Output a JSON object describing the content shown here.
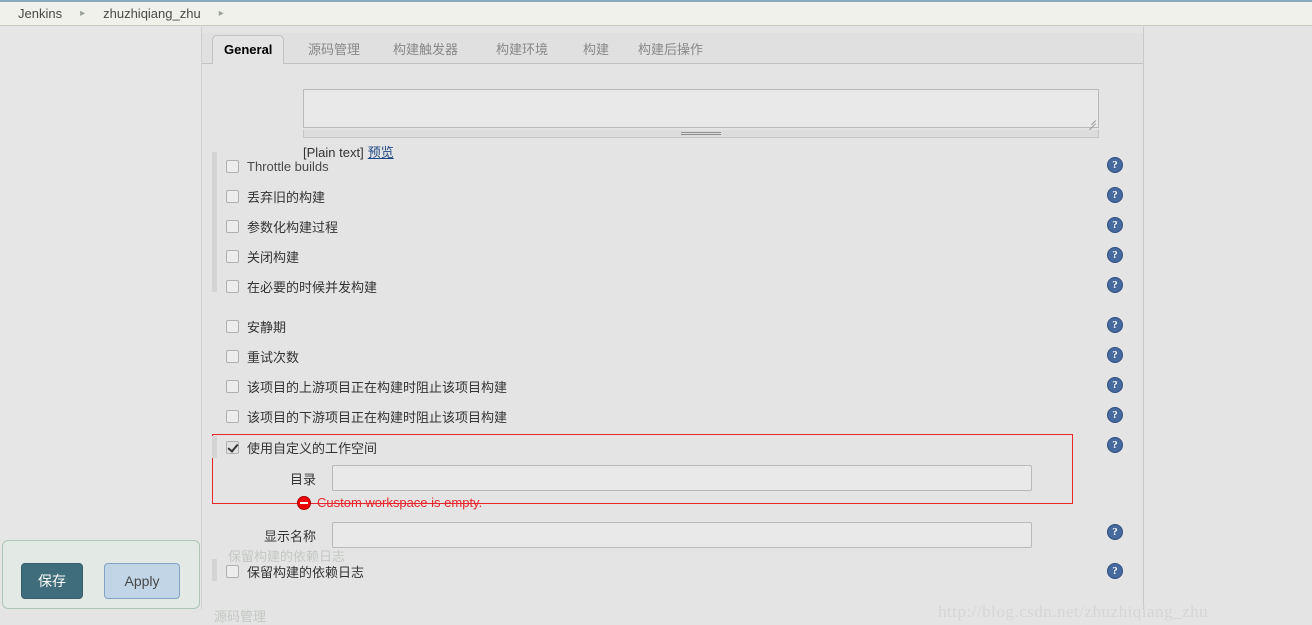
{
  "breadcrumb": {
    "items": [
      "Jenkins",
      "zhuzhiqiang_zhu"
    ],
    "separator": "▸"
  },
  "tabs": [
    {
      "label": "General",
      "active": true
    },
    {
      "label": "源码管理",
      "active": false
    },
    {
      "label": "构建触发器",
      "active": false
    },
    {
      "label": "构建环境",
      "active": false
    },
    {
      "label": "构建",
      "active": false
    },
    {
      "label": "构建后操作",
      "active": false
    }
  ],
  "description": {
    "value": "",
    "format_label": "[Plain text]",
    "preview_label": "预览"
  },
  "checkbox_group_1": [
    {
      "label": "Throttle builds",
      "checked": false,
      "lang": "en"
    },
    {
      "label": "丢弃旧的构建",
      "checked": false,
      "lang": "zh"
    },
    {
      "label": "参数化构建过程",
      "checked": false,
      "lang": "zh"
    },
    {
      "label": "关闭构建",
      "checked": false,
      "lang": "zh"
    },
    {
      "label": "在必要的时候并发构建",
      "checked": false,
      "lang": "zh"
    }
  ],
  "checkbox_group_2": [
    {
      "label": "安静期",
      "checked": false,
      "lang": "zh"
    },
    {
      "label": "重试次数",
      "checked": false,
      "lang": "zh"
    },
    {
      "label": "该项目的上游项目正在构建时阻止该项目构建",
      "checked": false,
      "lang": "zh"
    },
    {
      "label": "该项目的下游项目正在构建时阻止该项目构建",
      "checked": false,
      "lang": "zh"
    }
  ],
  "custom_workspace": {
    "checkbox_label": "使用自定义的工作空间",
    "checked": true,
    "directory_label": "目录",
    "directory_value": "",
    "error_message": "Custom workspace is empty.",
    "error_icon": "error-circle-icon",
    "highlight_color": "#e8272c"
  },
  "display_name": {
    "label": "显示名称",
    "value": ""
  },
  "keep_dependencies": {
    "label": "保留构建的依赖日志",
    "checked": false
  },
  "ghost_labels": {
    "behind_panel_1": "源码管理",
    "behind_panel_2": "保留构建的依赖日志"
  },
  "save_panel": {
    "save_label": "保存",
    "apply_label": "Apply",
    "save_color": "#336474",
    "apply_color": "#bfd4e7"
  },
  "help_icon": {
    "glyph": "?",
    "name": "help-icon",
    "color": "#46699e"
  },
  "watermark": {
    "text": "http://blog.csdn.net/zhuzhiqiang_zhu"
  }
}
